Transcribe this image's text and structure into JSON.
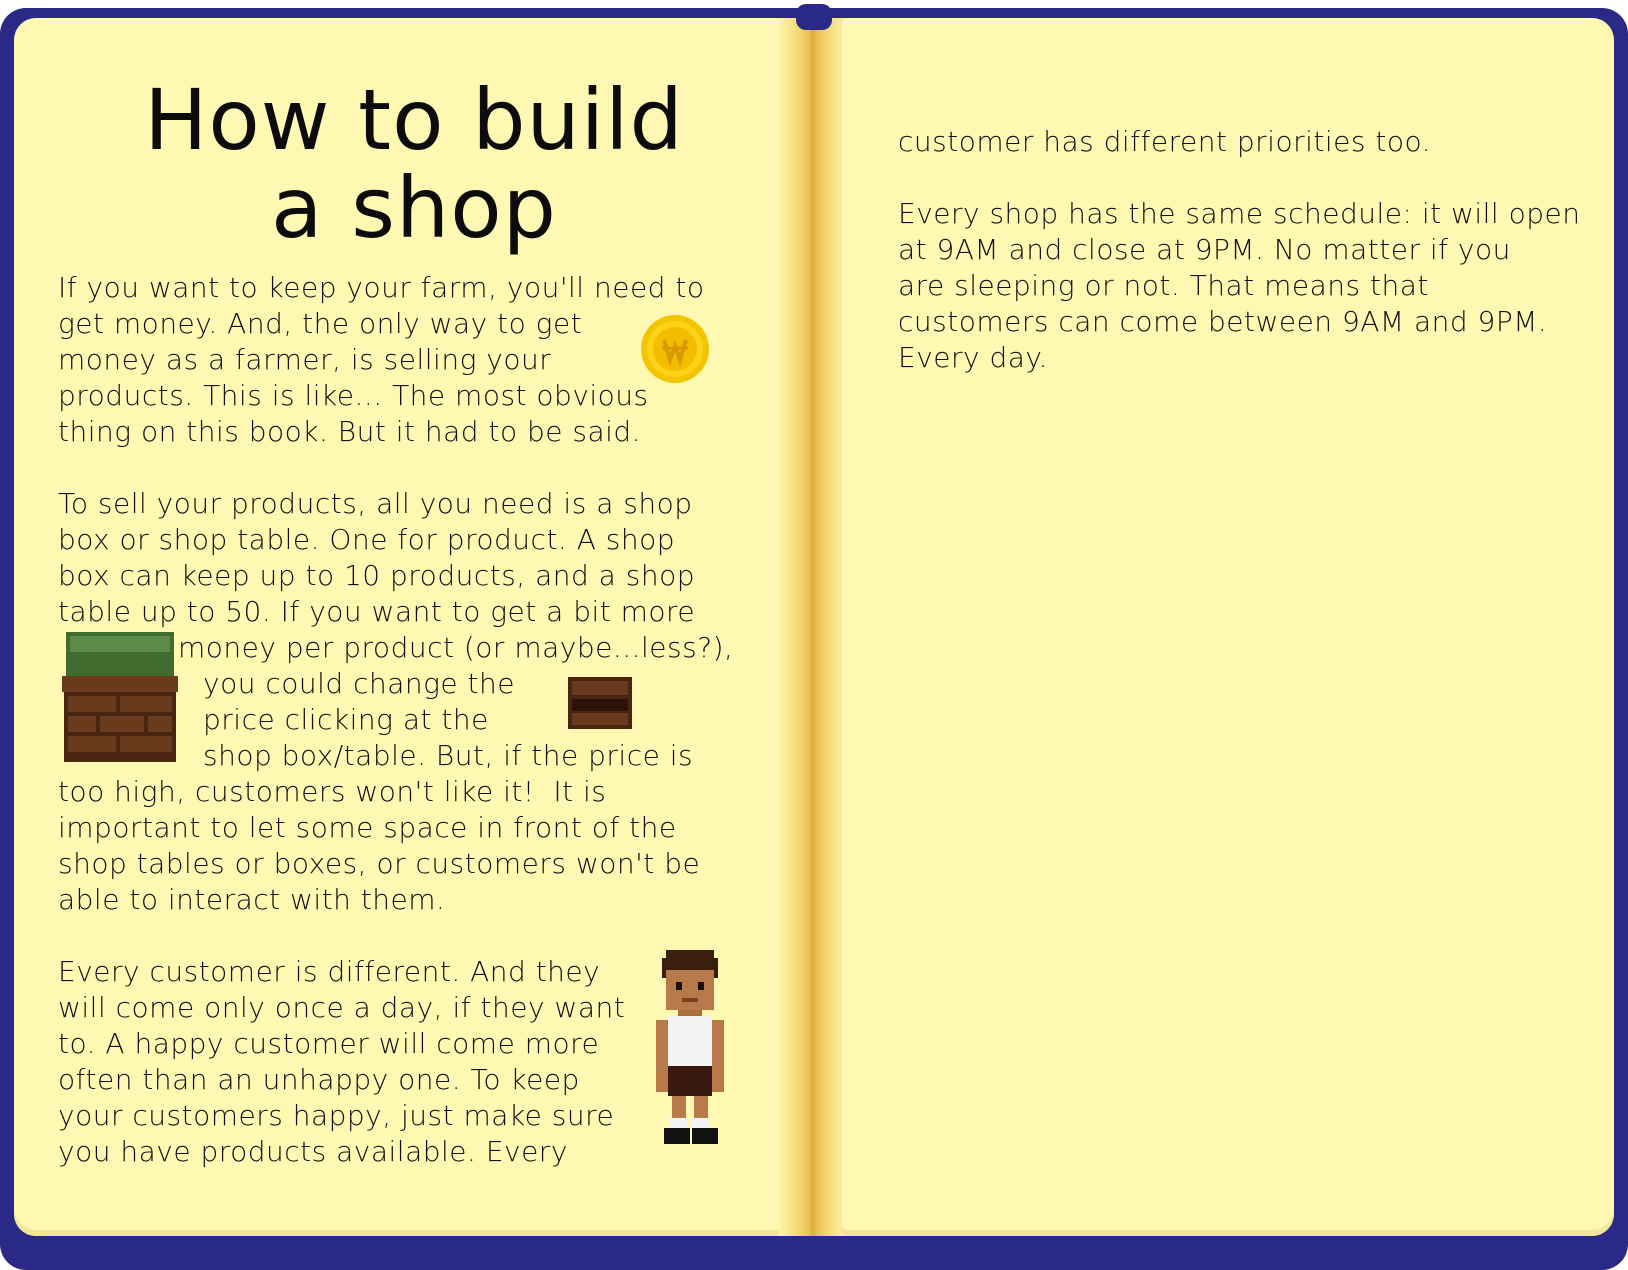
{
  "book": {
    "title_line1": "How to build",
    "title_line2": "a shop",
    "left_page": {
      "paragraph1": [
        "If you want to keep your farm, you'll need to",
        "get money. And, the only way to get",
        "money as a farmer, is selling your",
        "products. This is like... The most obvious",
        "thing on this book. But it had to be said."
      ],
      "paragraph2": [
        "To sell your products, all you need is a shop",
        "box or shop table. One for product. A shop",
        "box can keep up to 10 products, and a shop",
        "table up to 50. If you want to get a bit more",
        "money per product (or maybe...less?),",
        "you could change the",
        "price clicking at the",
        "shop box/table. But, if the price is",
        "too high, customers won't like it!  It is",
        "important to let some space in front of the",
        "shop tables or boxes, or customers won't be",
        "able to interact with them."
      ],
      "paragraph3": [
        "Every customer is different. And they",
        "will come only once a day, if they want",
        "to. A happy customer will come more",
        "often than an unhappy one. To keep",
        "your customers happy, just make sure",
        "you have products available. Every"
      ]
    },
    "right_page": {
      "paragraph1": [
        "customer has different priorities too."
      ],
      "paragraph2": [
        "Every shop has the same schedule: it will open",
        "at 9AM and close at 9PM. No matter if you",
        "are sleeping or not. That means that",
        "customers can come between 9AM and 9PM.",
        "Every day."
      ]
    }
  },
  "icons": [
    "coin-icon",
    "shop-box-icon",
    "shop-table-icon",
    "customer-sprite"
  ],
  "colors": {
    "frame": "#2a2a86",
    "page": "#fff8b2",
    "spine": "#e8c055",
    "text": "#111111"
  }
}
